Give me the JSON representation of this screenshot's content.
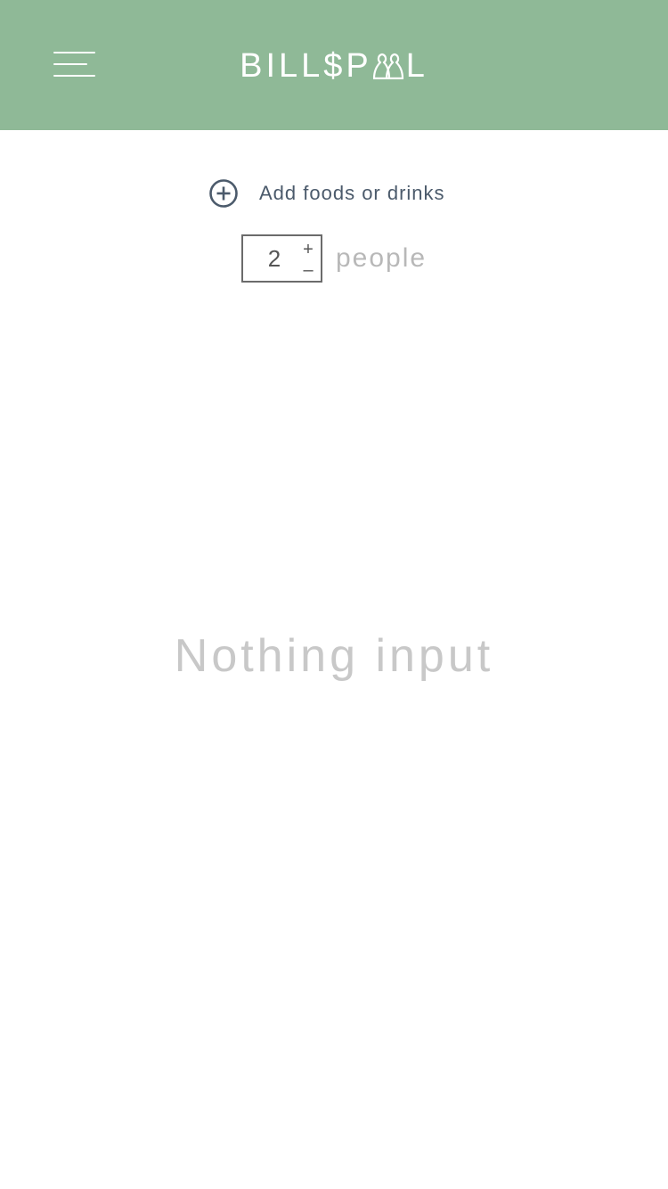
{
  "header": {
    "brand_color": "#8fb997",
    "logo_prefix": "BILL$P",
    "logo_suffix": "L",
    "menu_icon": "hamburger-menu-icon",
    "logo_icon": "people-pool-icon"
  },
  "add_item": {
    "icon": "plus-circle-icon",
    "label": "Add foods or drinks"
  },
  "people": {
    "count": "2",
    "increment_label": "+",
    "decrement_label": "–",
    "label": "people"
  },
  "empty_state": {
    "message": "Nothing input"
  }
}
